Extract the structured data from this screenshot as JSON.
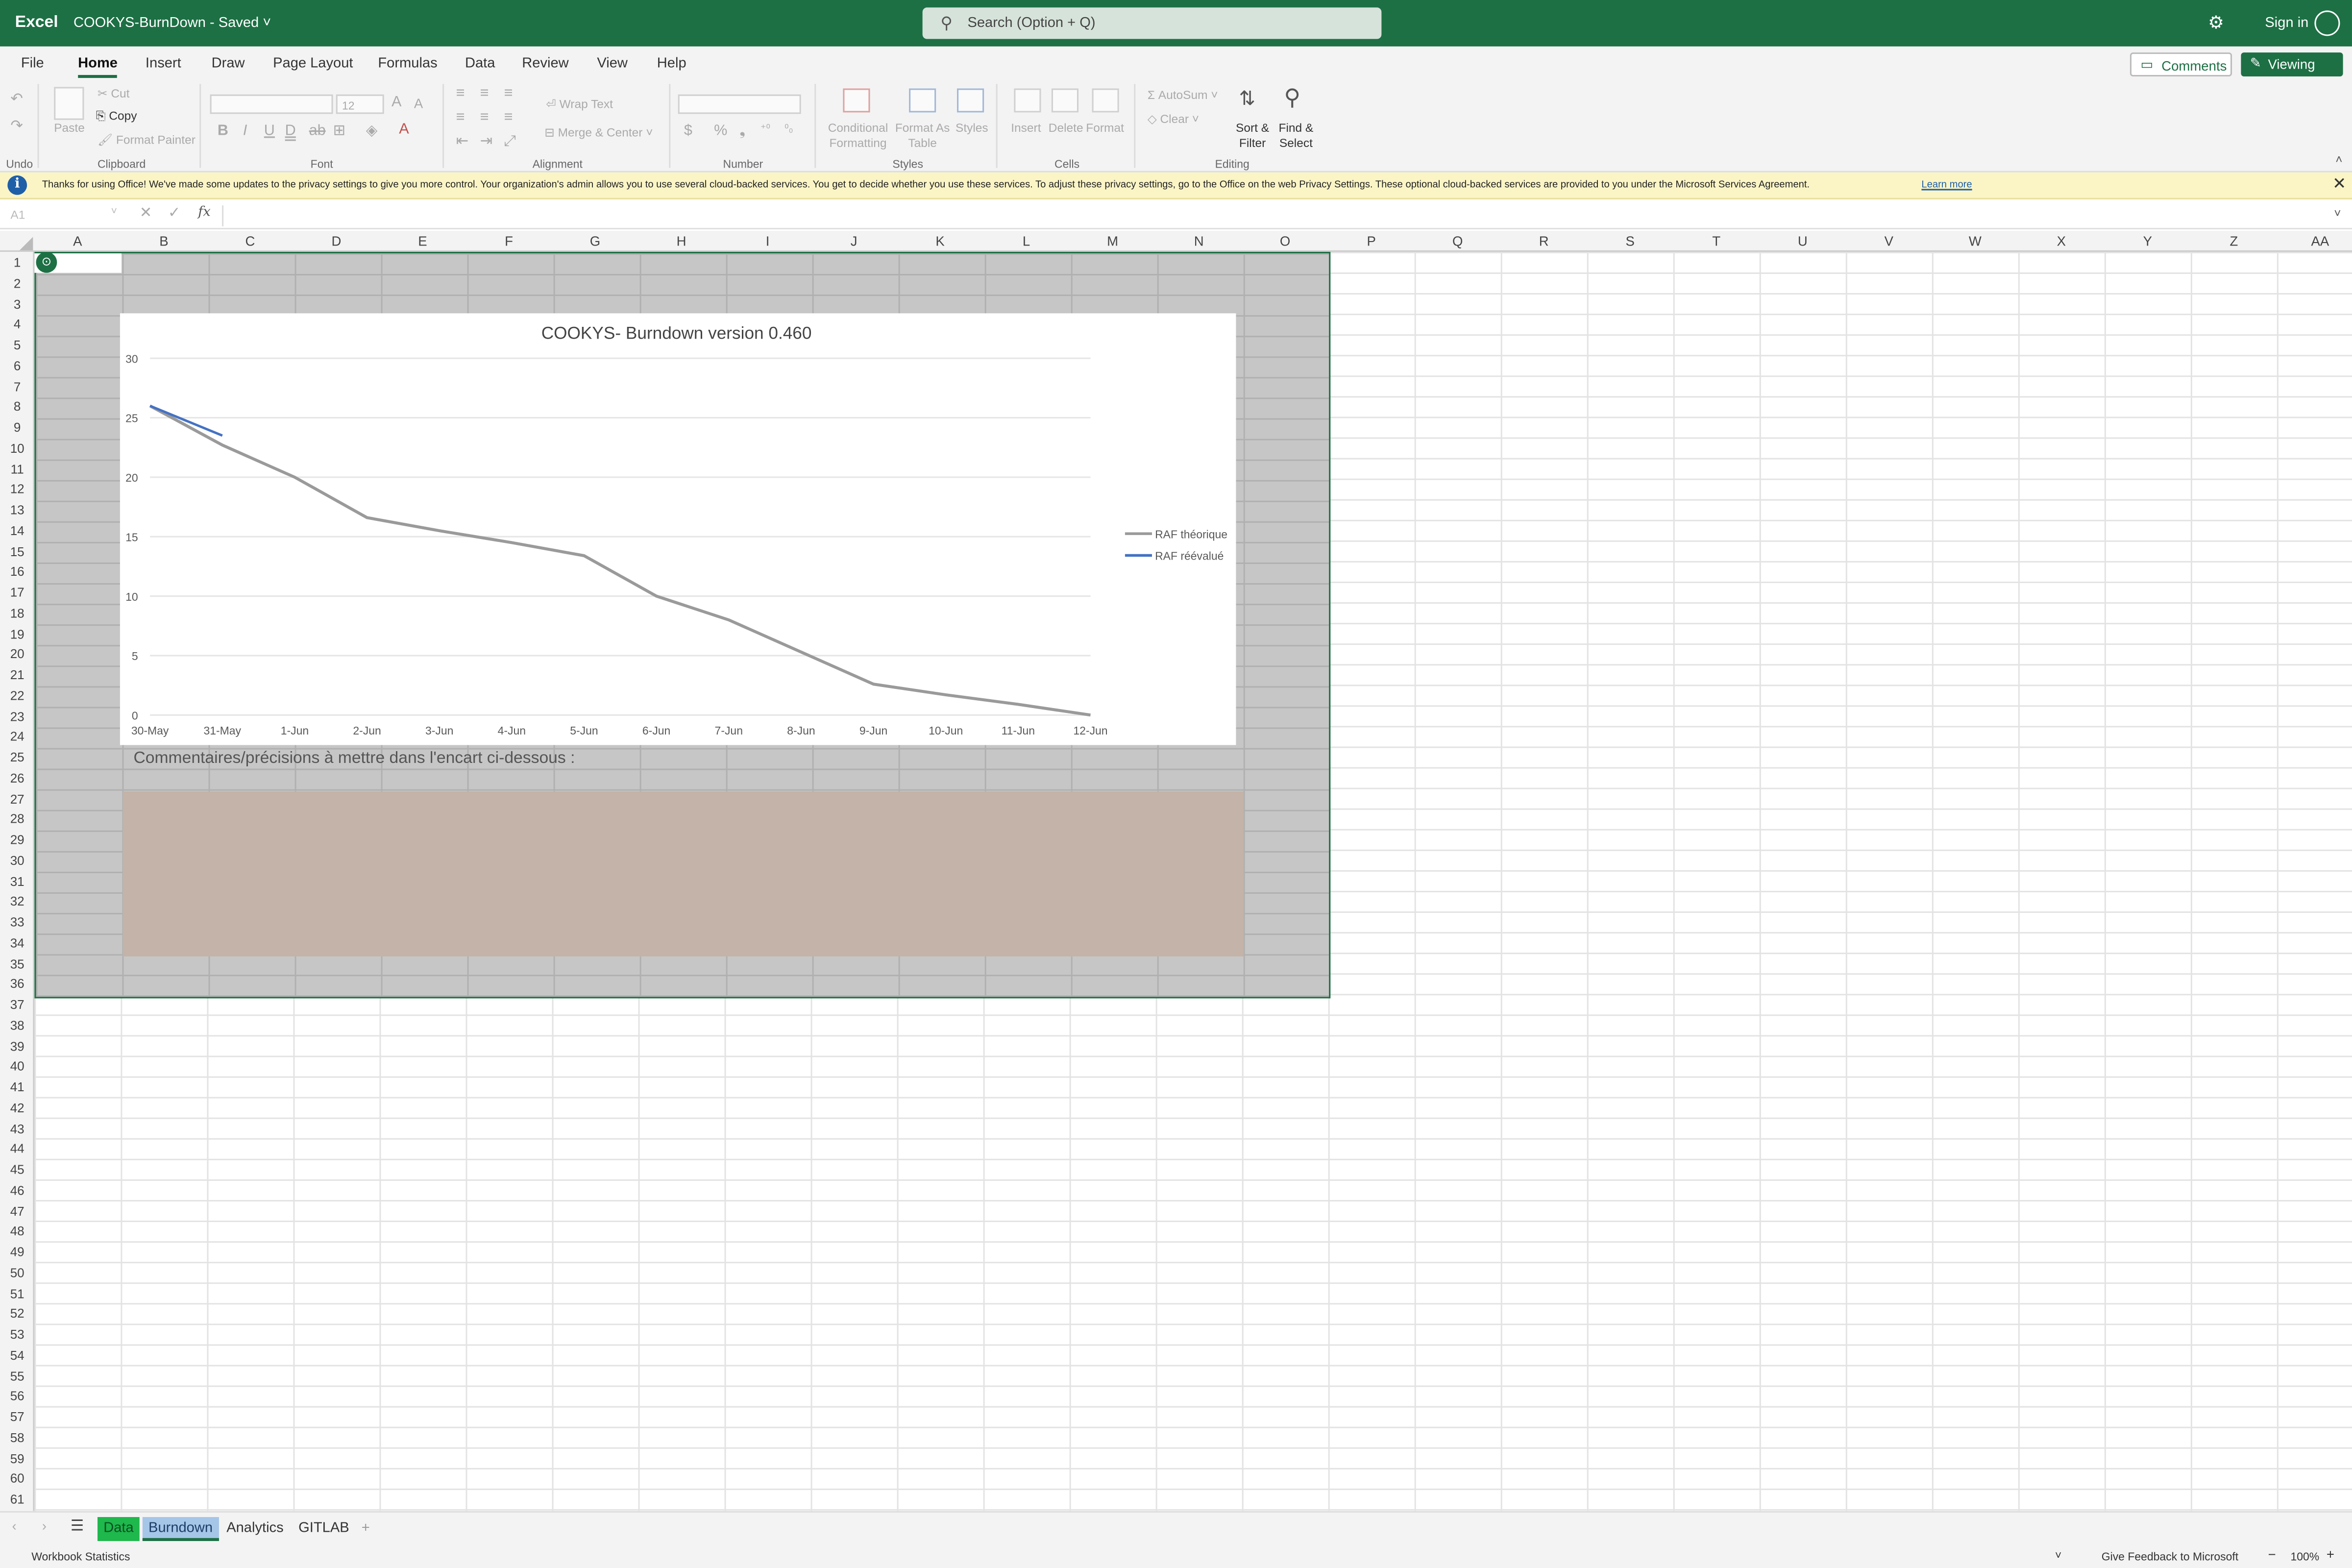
{
  "titlebar": {
    "app": "Excel",
    "doc": "COOKYS-BurnDown  -  Saved ˅",
    "search": "Search (Option + Q)",
    "signin": "Sign in"
  },
  "menu": {
    "tabs": [
      "File",
      "Home",
      "Insert",
      "Draw",
      "Page Layout",
      "Formulas",
      "Data",
      "Review",
      "View",
      "Help"
    ],
    "comments": "Comments",
    "viewing": "Viewing"
  },
  "ribbon": {
    "undo": "Undo",
    "paste": "Paste",
    "cut": "Cut",
    "copy": "Copy",
    "format_painter": "Format Painter",
    "clipboard": "Clipboard",
    "font_size": "12",
    "font": "Font",
    "wrap_text": "Wrap Text",
    "merge_center": "Merge & Center",
    "alignment": "Alignment",
    "number": "Number",
    "conditional_formatting": "Conditional Formatting",
    "format_as_table": "Format As Table",
    "styles_btn": "Styles",
    "styles": "Styles",
    "insert": "Insert",
    "delete": "Delete",
    "format": "Format",
    "cells": "Cells",
    "autosum": "AutoSum",
    "clear": "Clear",
    "sort_filter": "Sort & Filter",
    "find_select": "Find & Select",
    "editing": "Editing"
  },
  "infobar": {
    "message": "Thanks for using Office! We've made some updates to the privacy settings to give you more control. Your organization's admin allows you to use several cloud-backed services. You get to decide whether you use these services. To adjust these privacy settings, go to the Office on the web Privacy Settings. These optional cloud-backed services are provided to you under the Microsoft Services Agreement.",
    "learn_more": "Learn more"
  },
  "formula_bar": {
    "name_box": "A1",
    "fx": "fx"
  },
  "columns": [
    "A",
    "B",
    "C",
    "D",
    "E",
    "F",
    "G",
    "H",
    "I",
    "J",
    "K",
    "L",
    "M",
    "N",
    "O",
    "P",
    "Q",
    "R",
    "S",
    "T",
    "U",
    "V",
    "W",
    "X",
    "Y",
    "Z",
    "AA"
  ],
  "sheet": {
    "comment_label": "Commentaires/précisions à mettre dans l'encart ci-dessous :"
  },
  "chart_data": {
    "type": "line",
    "title": "COOKYS- Burndown version 0.460",
    "categories": [
      "30-May",
      "31-May",
      "1-Jun",
      "2-Jun",
      "3-Jun",
      "4-Jun",
      "5-Jun",
      "6-Jun",
      "7-Jun",
      "8-Jun",
      "9-Jun",
      "10-Jun",
      "11-Jun",
      "12-Jun"
    ],
    "ylim": [
      0,
      30
    ],
    "yticks": [
      0,
      5,
      10,
      15,
      20,
      25,
      30
    ],
    "grid": true,
    "legend": "right",
    "series": [
      {
        "name": "RAF théorique",
        "color": "#9a9a9a",
        "values": [
          26,
          22.7,
          20,
          16.6,
          15.5,
          14.5,
          13.4,
          10,
          8,
          5.3,
          2.6,
          1.7,
          0.9,
          0
        ]
      },
      {
        "name": "RAF réévalué",
        "color": "#4472c4",
        "values": [
          26,
          23.5
        ]
      }
    ]
  },
  "sheets": {
    "tabs": [
      "Data",
      "Burndown",
      "Analytics",
      "GITLAB"
    ],
    "add": "+"
  },
  "status": {
    "left": "Workbook Statistics",
    "feedback": "Give Feedback to Microsoft",
    "zoom": "100%"
  }
}
